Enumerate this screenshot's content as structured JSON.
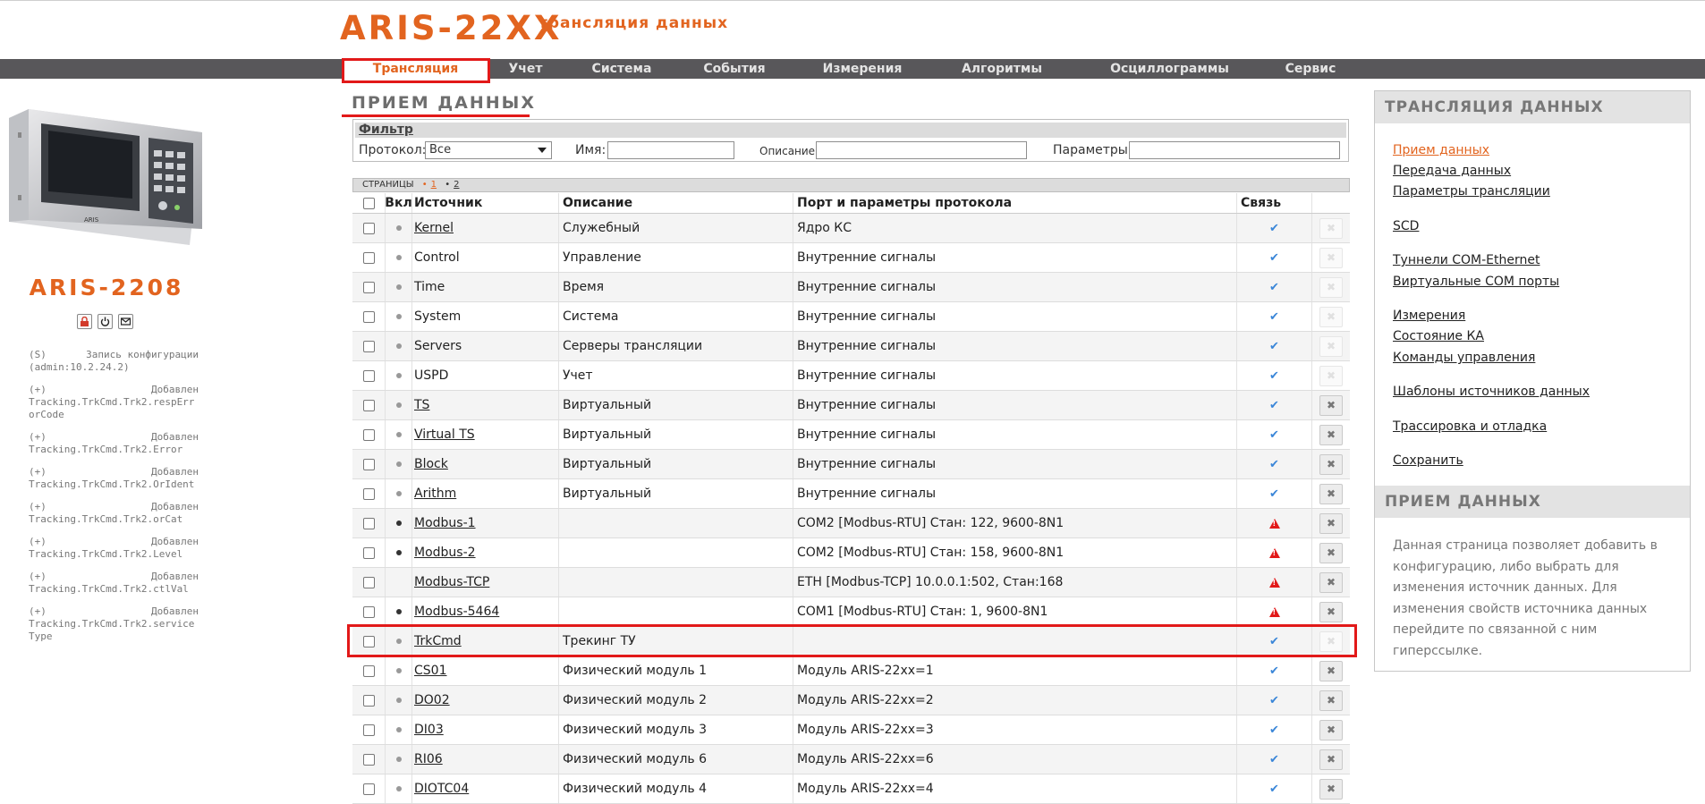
{
  "brand": {
    "main": "ARIS-22XX",
    "sub": "трансляция данных"
  },
  "nav": [
    "Трансляция",
    "Учет",
    "Система",
    "События",
    "Измерения",
    "Алгоритмы",
    "Осциллограммы",
    "Сервис"
  ],
  "page_title": "ПРИЕМ ДАННЫХ",
  "device": {
    "model": "ARIS-2208",
    "panel_label": "ARIS"
  },
  "log": [
    {
      "prefix": "(S)",
      "action": "Запись конфигурации",
      "detail": "(admin:10.2.24.2)"
    },
    {
      "prefix": "(+)",
      "action": "Добавлен",
      "detail": "Tracking.TrkCmd.Trk2.respErrorCode"
    },
    {
      "prefix": "(+)",
      "action": "Добавлен",
      "detail": "Tracking.TrkCmd.Trk2.Error"
    },
    {
      "prefix": "(+)",
      "action": "Добавлен",
      "detail": "Tracking.TrkCmd.Trk2.OrIdent"
    },
    {
      "prefix": "(+)",
      "action": "Добавлен",
      "detail": "Tracking.TrkCmd.Trk2.orCat"
    },
    {
      "prefix": "(+)",
      "action": "Добавлен",
      "detail": "Tracking.TrkCmd.Trk2.Level"
    },
    {
      "prefix": "(+)",
      "action": "Добавлен",
      "detail": "Tracking.TrkCmd.Trk2.ctlVal"
    },
    {
      "prefix": "(+)",
      "action": "Добавлен",
      "detail": "Tracking.TrkCmd.Trk2.serviceType"
    }
  ],
  "filter": {
    "title": "Фильтр",
    "protocol_label": "Протокол:",
    "protocol_value": "Все",
    "name_label": "Имя:",
    "name_value": "",
    "desc_label": "Описание:",
    "desc_value": "",
    "params_label": "Параметры:",
    "params_value": ""
  },
  "pages": {
    "label": "СТРАНИЦЫ",
    "items": [
      "1",
      "2"
    ]
  },
  "table": {
    "headers": {
      "enabled": "Вкл",
      "source": "Источник",
      "description": "Описание",
      "port": "Порт и параметры протокола",
      "link": "Связь"
    },
    "rows": [
      {
        "source": "Kernel",
        "link": true,
        "description": "Служебный",
        "port": "Ядро КС",
        "status": "ok",
        "deletable": false,
        "dot": "gray"
      },
      {
        "source": "Control",
        "link": false,
        "description": "Управление",
        "port": "Внутренние сигналы",
        "status": "ok",
        "deletable": false,
        "dot": "gray"
      },
      {
        "source": "Time",
        "link": false,
        "description": "Время",
        "port": "Внутренние сигналы",
        "status": "ok",
        "deletable": false,
        "dot": "gray"
      },
      {
        "source": "System",
        "link": false,
        "description": "Система",
        "port": "Внутренние сигналы",
        "status": "ok",
        "deletable": false,
        "dot": "gray"
      },
      {
        "source": "Servers",
        "link": false,
        "description": "Серверы трансляции",
        "port": "Внутренние сигналы",
        "status": "ok",
        "deletable": false,
        "dot": "gray"
      },
      {
        "source": "USPD",
        "link": false,
        "description": "Учет",
        "port": "Внутренние сигналы",
        "status": "ok",
        "deletable": false,
        "dot": "gray"
      },
      {
        "source": "TS",
        "link": true,
        "description": "Виртуальный",
        "port": "Внутренние сигналы",
        "status": "ok",
        "deletable": true,
        "dot": "gray"
      },
      {
        "source": "Virtual TS",
        "link": true,
        "description": "Виртуальный",
        "port": "Внутренние сигналы",
        "status": "ok",
        "deletable": true,
        "dot": "gray"
      },
      {
        "source": "Block",
        "link": true,
        "description": "Виртуальный",
        "port": "Внутренние сигналы",
        "status": "ok",
        "deletable": true,
        "dot": "gray"
      },
      {
        "source": "Arithm",
        "link": true,
        "description": "Виртуальный",
        "port": "Внутренние сигналы",
        "status": "ok",
        "deletable": true,
        "dot": "gray"
      },
      {
        "source": "Modbus-1",
        "link": true,
        "description": "",
        "port": "COM2 [Modbus-RTU] Стан: 122, 9600-8N1",
        "status": "error",
        "deletable": true,
        "dot": "dark"
      },
      {
        "source": "Modbus-2",
        "link": true,
        "description": "",
        "port": "COM2 [Modbus-RTU] Стан: 158, 9600-8N1",
        "status": "error",
        "deletable": true,
        "dot": "dark"
      },
      {
        "source": "Modbus-TCP",
        "link": true,
        "description": "",
        "port": "ETH [Modbus-TCP] 10.0.0.1:502, Стан:168",
        "status": "error",
        "deletable": true,
        "dot": "none"
      },
      {
        "source": "Modbus-5464",
        "link": true,
        "description": "",
        "port": "COM1 [Modbus-RTU] Стан: 1, 9600-8N1",
        "status": "error",
        "deletable": true,
        "dot": "dark"
      },
      {
        "source": "TrkCmd",
        "link": true,
        "description": "Трекинг ТУ",
        "port": "",
        "status": "ok",
        "deletable": false,
        "dot": "gray"
      },
      {
        "source": "CS01",
        "link": true,
        "description": "Физический модуль 1",
        "port": "Модуль ARIS-22xx=1",
        "status": "ok",
        "deletable": true,
        "dot": "gray"
      },
      {
        "source": "DO02",
        "link": true,
        "description": "Физический модуль 2",
        "port": "Модуль ARIS-22xx=2",
        "status": "ok",
        "deletable": true,
        "dot": "gray"
      },
      {
        "source": "DI03",
        "link": true,
        "description": "Физический модуль 3",
        "port": "Модуль ARIS-22xx=3",
        "status": "ok",
        "deletable": true,
        "dot": "gray"
      },
      {
        "source": "RI06",
        "link": true,
        "description": "Физический модуль 6",
        "port": "Модуль ARIS-22xx=6",
        "status": "ok",
        "deletable": true,
        "dot": "gray"
      },
      {
        "source": "DIOTC04",
        "link": true,
        "description": "Физический модуль 4",
        "port": "Модуль ARIS-22xx=4",
        "status": "ok",
        "deletable": true,
        "dot": "gray"
      }
    ]
  },
  "sidebar": {
    "section1_title": "ТРАНСЛЯЦИЯ ДАННЫХ",
    "links": [
      "Прием данных",
      "Передача данных",
      "Параметры трансляции",
      "SCD",
      "Туннели COM-Ethernet",
      "Виртуальные COM порты",
      "Измерения",
      "Состояние КА",
      "Команды управления",
      "Шаблоны источников данных",
      "Трассировка и отладка",
      "Сохранить"
    ],
    "section2_title": "ПРИЕМ ДАННЫХ",
    "description": "Данная страница позволяет добавить в конфигурацию, либо выбрать для изменения источник данных. Для изменения свойств источника данных перейдите по связанной с ним гиперссылке."
  },
  "colors": {
    "accent": "#e2641f",
    "nav_bg": "#58575a",
    "highlight": "#e21919",
    "ok": "#3a86d8"
  }
}
